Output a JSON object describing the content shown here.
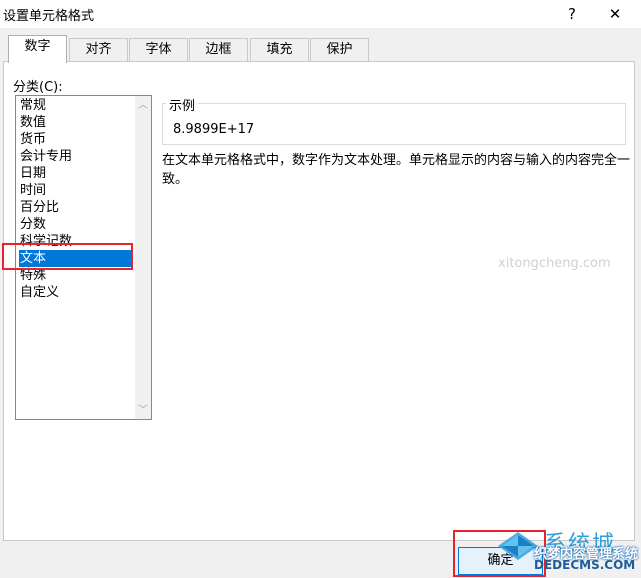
{
  "window": {
    "title": "设置单元格格式",
    "help_glyph": "?",
    "close_glyph": "✕"
  },
  "tabs": [
    {
      "label": "数字",
      "active": true
    },
    {
      "label": "对齐"
    },
    {
      "label": "字体"
    },
    {
      "label": "边框"
    },
    {
      "label": "填充"
    },
    {
      "label": "保护"
    }
  ],
  "category": {
    "label": "分类(C):",
    "items": [
      "常规",
      "数值",
      "货币",
      "会计专用",
      "日期",
      "时间",
      "百分比",
      "分数",
      "科学记数",
      "文本",
      "特殊",
      "自定义"
    ],
    "selected": "文本"
  },
  "sample": {
    "legend": "示例",
    "value": "8.9899E+17"
  },
  "description": "在文本单元格格式中，数字作为文本处理。单元格显示的内容与输入的内容完全一致。",
  "buttons": {
    "ok": "确定"
  },
  "watermark": {
    "brand": "系统城",
    "line1": "织梦内容管理系统",
    "line2": "DEDECMS.COM",
    "site": "xitongcheng.com"
  },
  "colors": {
    "selection": "#0078d7",
    "highlight_box": "#e8232b"
  },
  "icons": {
    "help": "help-icon",
    "close": "close-icon",
    "scroll_up": "chevron-up-icon",
    "scroll_down": "chevron-down-icon"
  }
}
